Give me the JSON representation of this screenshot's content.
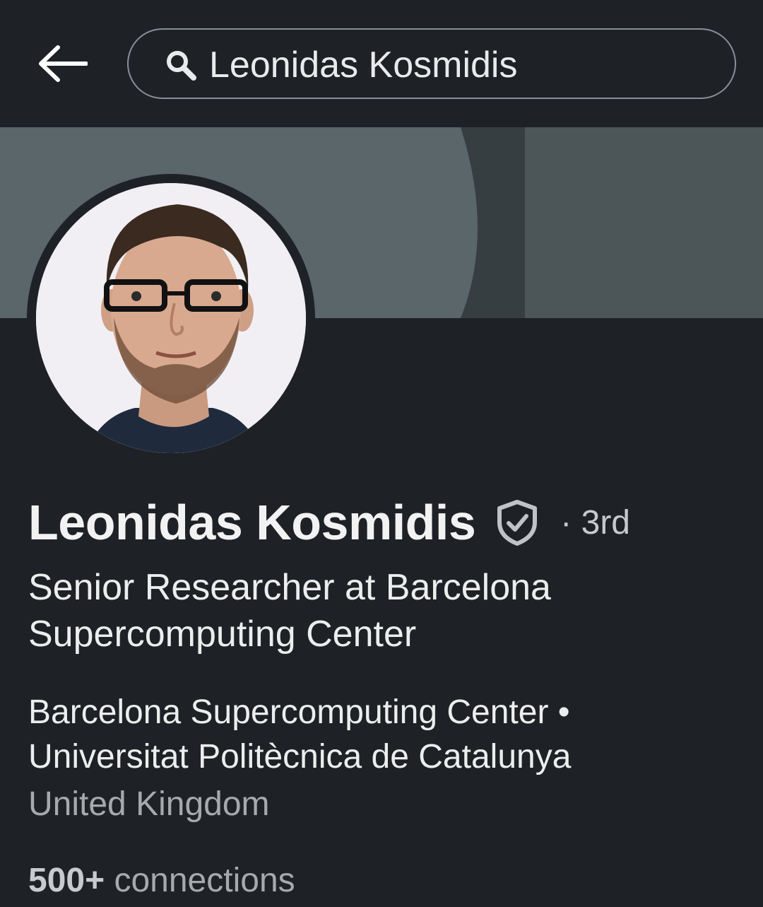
{
  "search": {
    "query": "Leonidas Kosmidis"
  },
  "profile": {
    "name": "Leonidas Kosmidis",
    "degree": "· 3rd",
    "headline": "Senior Researcher at Barcelona Supercomputing Center",
    "company": "Barcelona Supercomputing Center • Universitat Politècnica de Catalunya",
    "location": "United Kingdom",
    "connections_count": "500+",
    "connections_label": " connections"
  },
  "icons": {
    "back": "arrow-left-icon",
    "search": "search-icon",
    "verified": "verified-shield-icon"
  },
  "colors": {
    "background": "#1e2126",
    "banner": "#4b5458",
    "text_primary": "#f2f2f2",
    "text_secondary": "#a6a9ad"
  }
}
